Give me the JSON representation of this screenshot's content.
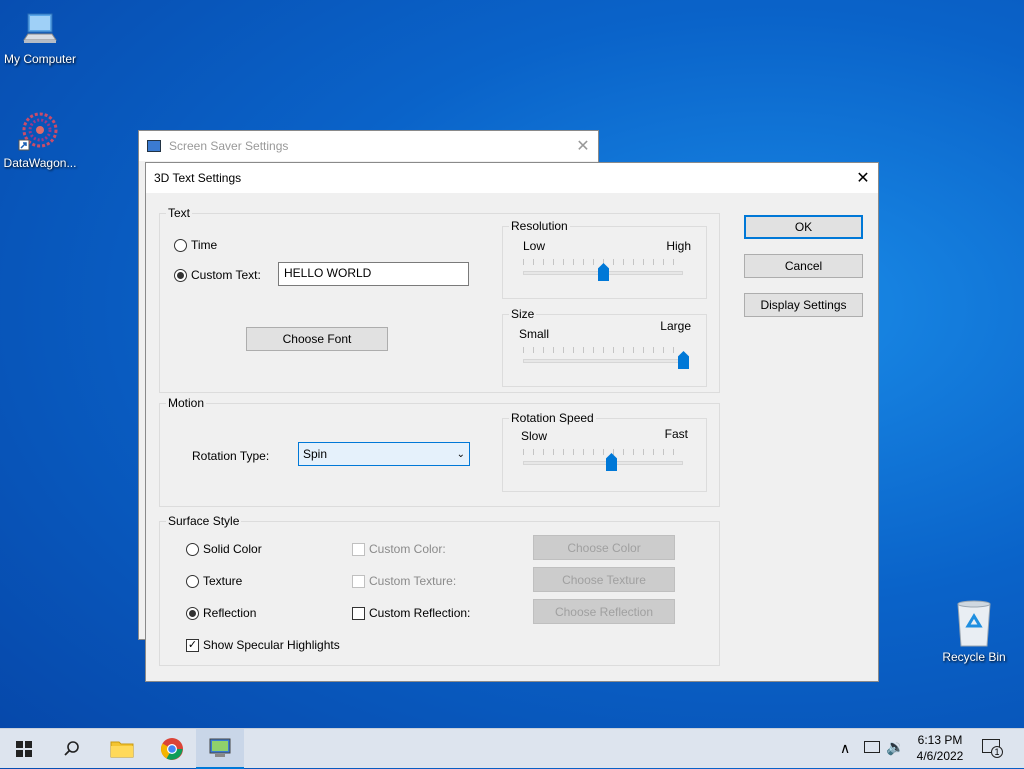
{
  "desktop": {
    "icons": [
      {
        "label": "My Computer"
      },
      {
        "label": "DataWagon..."
      },
      {
        "label": "Recycle Bin"
      }
    ]
  },
  "back_window": {
    "title": "Screen Saver Settings",
    "close": "✕"
  },
  "dialog": {
    "title": "3D Text Settings",
    "close": "✕",
    "text_group": {
      "label": "Text",
      "time_label": "Time",
      "custom_text_label": "Custom Text:",
      "custom_text_value": "HELLO WORLD",
      "choose_font": "Choose Font",
      "selected": "custom"
    },
    "resolution": {
      "label": "Resolution",
      "low": "Low",
      "high": "High",
      "value": 0.5
    },
    "size": {
      "label": "Size",
      "small": "Small",
      "large": "Large",
      "value": 1.0
    },
    "motion": {
      "label": "Motion",
      "rotation_type_label": "Rotation Type:",
      "rotation_type_value": "Spin"
    },
    "rotation_speed": {
      "label": "Rotation Speed",
      "slow": "Slow",
      "fast": "Fast",
      "value": 0.55
    },
    "surface": {
      "label": "Surface Style",
      "solid_color": "Solid Color",
      "texture": "Texture",
      "reflection": "Reflection",
      "selected": "reflection",
      "custom_color": "Custom Color:",
      "custom_texture": "Custom Texture:",
      "custom_reflection": "Custom Reflection:",
      "choose_color": "Choose Color",
      "choose_texture": "Choose Texture",
      "choose_reflection": "Choose Reflection",
      "show_specular": "Show Specular Highlights",
      "show_specular_checked": true
    },
    "buttons": {
      "ok": "OK",
      "cancel": "Cancel",
      "display_settings": "Display Settings"
    }
  },
  "taskbar": {
    "time": "6:13 PM",
    "date": "4/6/2022",
    "notification_count": "1"
  },
  "colors": {
    "accent": "#0078d7"
  }
}
